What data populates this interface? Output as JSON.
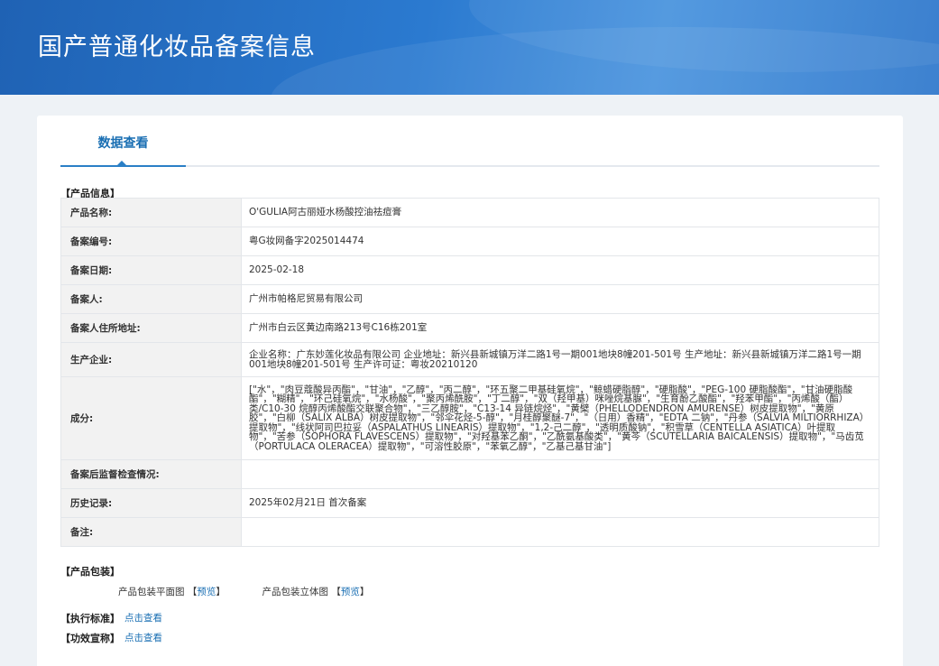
{
  "banner": {
    "title": "国产普通化妆品备案信息"
  },
  "tabs": {
    "active": "数据查看"
  },
  "product_info": {
    "section_title": "【产品信息】",
    "rows": [
      {
        "label": "产品名称:",
        "value": "O'GULIA阿古丽娅水杨酸控油祛痘膏"
      },
      {
        "label": "备案编号:",
        "value": "粤G妆网备字2025014474"
      },
      {
        "label": "备案日期:",
        "value": "2025-02-18"
      },
      {
        "label": "备案人:",
        "value": "广州市帕格尼贸易有限公司"
      },
      {
        "label": "备案人住所地址:",
        "value": "广州市白云区黄边南路213号C16栋201室"
      },
      {
        "label": "生产企业:",
        "value": "企业名称：广东妙莲化妆品有限公司 企业地址：新兴县新城镇万洋二路1号一期001地块8幢201-501号 生产地址：新兴县新城镇万洋二路1号一期001地块8幢201-501号 生产许可证：粤妆20210120"
      },
      {
        "label": "成分:",
        "value": "[\"水\"，\"肉豆蔻酸异丙酯\"，\"甘油\"，\"乙醇\"，\"丙二醇\"，\"环五聚二甲基硅氧烷\"，\"鲸蜡硬脂醇\"，\"硬脂酸\"，\"PEG-100 硬脂酸酯\"，\"甘油硬脂酸酯\"，\"糊精\"，\"环己硅氧烷\"，\"水杨酸\"，\"聚丙烯酰胺\"，\"丁二醇\"，\"双（羟甲基）咪唑烷基脲\"，\"生育酚乙酸酯\"，\"羟苯甲酯\"，\"丙烯酸（酯）类/C10-30 烷醇丙烯酸酯交联聚合物\"，\"三乙醇胺\"，\"C13-14 异链烷烃\"，\"黄檗（PHELLODENDRON AMURENSE）树皮提取物\"，\"黄原胶\"，\"白柳（SALIX ALBA）树皮提取物\"，\"邻伞花烃-5-醇\"，\"月桂醇聚醚-7\"，\"（日用）香精\"，\"EDTA 二钠\"，\"丹参（SALVIA MILTIORRHIZA）提取物\"，\"线状阿司巴拉妥（ASPALATHUS LINEARIS）提取物\"，\"1,2-己二醇\"，\"透明质酸钠\"，\"积雪草（CENTELLA ASIATICA）叶提取物\"，\"苦参（SOPHORA FLAVESCENS）提取物\"，\"对羟基苯乙酮\"，\"乙酰氨基酸类\"，\"黄芩（SCUTELLARIA BAICALENSIS）提取物\"，\"马齿苋（PORTULACA OLERACEA）提取物\"，\"可溶性胶原\"，\"苯氧乙醇\"，\"乙基己基甘油\"]"
      },
      {
        "label": "备案后监督检查情况:",
        "value": ""
      },
      {
        "label": "历史记录:",
        "value": "2025年02月21日 首次备案"
      },
      {
        "label": "备注:",
        "value": ""
      }
    ]
  },
  "packaging": {
    "section_title": "【产品包装】",
    "flat_label": "产品包装平面图",
    "three_d_label": "产品包装立体图",
    "bracket_open": "【",
    "preview_link": "预览",
    "bracket_close": "】"
  },
  "standard": {
    "section_title": "【执行标准】",
    "link": "点击查看"
  },
  "efficacy": {
    "section_title": "【功效宣称】",
    "link": "点击查看"
  }
}
